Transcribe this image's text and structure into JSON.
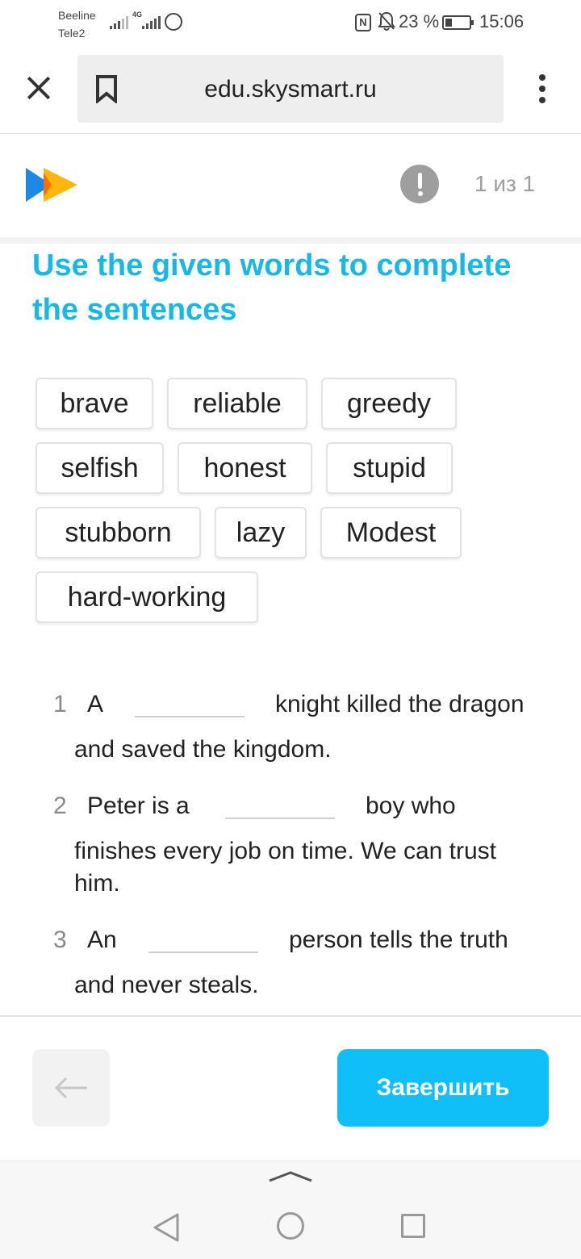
{
  "status_bar": {
    "carrier_1": "Beeline",
    "carrier_2": "Tele2",
    "network_label": "4G",
    "battery": "23 %",
    "time": "15:06"
  },
  "browser": {
    "url": "edu.skysmart.ru"
  },
  "header": {
    "page_counter": "1 из 1",
    "logo_colors": [
      "#1e88e5",
      "#ffb300"
    ]
  },
  "task": {
    "title": "Use the given words to complete the sentences",
    "words": [
      "brave",
      "reliable",
      "greedy",
      "selfish",
      "honest",
      "stupid",
      "stubborn",
      "lazy",
      "Modest",
      "hard-working"
    ],
    "sentences": [
      {
        "number": "1",
        "before": "A",
        "after": "knight killed the dragon",
        "continuation": "and saved the kingdom."
      },
      {
        "number": "2",
        "before": "Peter is a",
        "after": "boy who",
        "continuation": "finishes every job on time. We can trust",
        "continuation_2": "him."
      },
      {
        "number": "3",
        "before": "An",
        "after": "person tells the truth",
        "continuation": "and never steals."
      }
    ]
  },
  "footer": {
    "finish_label": "Завершить"
  },
  "colors": {
    "accent_title": "#18b7e6",
    "finish_button": "#10bff7"
  }
}
